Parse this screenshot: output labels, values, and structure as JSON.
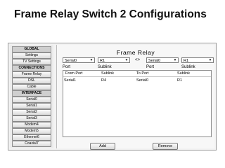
{
  "slide": {
    "title": "Frame Relay Switch 2 Configurations"
  },
  "sidebar": {
    "global_header": "GLOBAL",
    "global_items": [
      "Settings",
      "TV Settings"
    ],
    "connections_header": "CONNECTIONS",
    "connection_items": [
      "Frame Relay",
      "DSL",
      "Cable"
    ],
    "interface_header": "INTERFACE",
    "interface_items": [
      "Serial0",
      "Serial1",
      "Serial2",
      "Serial3",
      "Modem4",
      "Modem5",
      "Ethernet6",
      "Coaxial7"
    ]
  },
  "main": {
    "title": "Frame Relay",
    "left_port": "Serial0",
    "left_sublink": "R1",
    "arrows": "<>",
    "right_port": "Serial0",
    "right_sublink": "R1",
    "labels": {
      "port": "Port",
      "sublink": "Sublink"
    },
    "table": {
      "columns": [
        "From Port",
        "Sublink",
        "To Port",
        "Sublink"
      ],
      "rows": [
        [
          "Serial1",
          "R4",
          "Serial0",
          "R1"
        ]
      ]
    },
    "add_label": "Add",
    "remove_label": "Remove"
  }
}
